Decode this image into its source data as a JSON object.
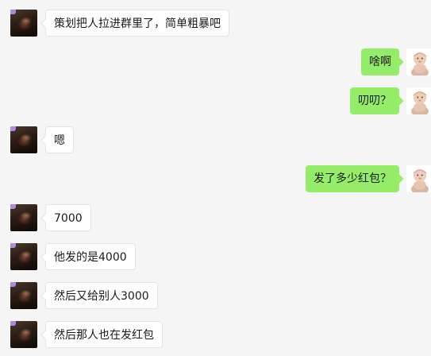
{
  "colors": {
    "background": "#f5f5f5",
    "incoming_bubble": "#ffffff",
    "outgoing_bubble": "#95ec69"
  },
  "messages": [
    {
      "side": "left",
      "avatar": "dark-portrait-avatar",
      "text": "策划把人拉进群里了，简单粗暴吧"
    },
    {
      "side": "right",
      "avatar": "baby-avatar",
      "text": "啥啊"
    },
    {
      "side": "right",
      "avatar": "baby-avatar",
      "text": "叨叨？"
    },
    {
      "side": "left",
      "avatar": "dark-portrait-avatar",
      "text": "嗯"
    },
    {
      "side": "right",
      "avatar": "baby-avatar",
      "text": "发了多少红包？"
    },
    {
      "side": "left",
      "avatar": "dark-portrait-avatar",
      "text": "7000"
    },
    {
      "side": "left",
      "avatar": "dark-portrait-avatar",
      "text": "他发的是4000"
    },
    {
      "side": "left",
      "avatar": "dark-portrait-avatar",
      "text": "然后又给别人3000"
    },
    {
      "side": "left",
      "avatar": "dark-portrait-avatar",
      "text": "然后那人也在发红包"
    }
  ]
}
